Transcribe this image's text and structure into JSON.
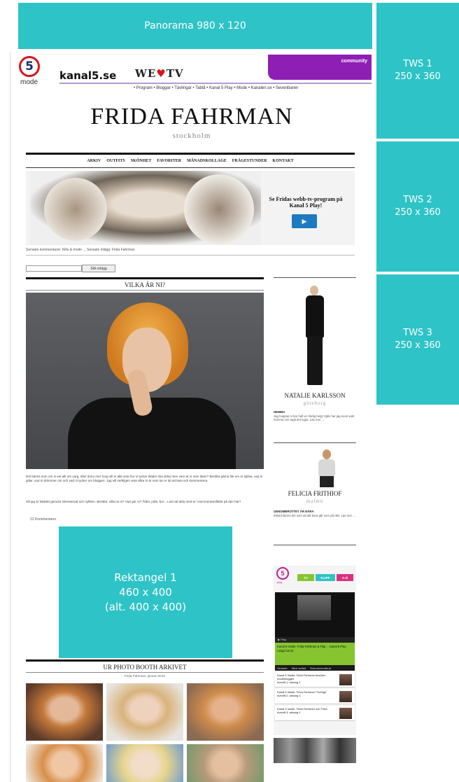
{
  "ads": {
    "panorama": {
      "title": "Panorama 980 x 120"
    },
    "tws1": {
      "title": "TWS 1",
      "size": "250 x 360"
    },
    "tws2": {
      "title": "TWS 2",
      "size": "250 x 360"
    },
    "tws3": {
      "title": "TWS 3",
      "size": "250 x 360"
    },
    "rektangel": {
      "title": "Rektangel 1",
      "size": "460 x 400",
      "alt": "(alt. 400 x 400)"
    }
  },
  "header": {
    "logo_number": "5",
    "logo_sub": "mode",
    "site_name": "kanal5.se",
    "brand_pre": "WE",
    "brand_heart": "♥",
    "brand_post": "TV",
    "community": "community",
    "top_nav": "• Program • Bloggar • Tävlingar • Tablå • Kanal 5 Play • Mode • Kanalen.se • Sevenbaren"
  },
  "blog": {
    "title": "FRIDA FAHRMAN",
    "city": "stockholm"
  },
  "nav": {
    "items": [
      "ARKIV",
      "OUTFITS",
      "SKÖNHET",
      "FAVORITER",
      "MÅNADSKOLLAGE",
      "FRÅGESTUNDER",
      "KONTAKT"
    ]
  },
  "banner": {
    "text": "Se Fridas webb-tv-program på Kanal 5 Play!",
    "play_icon": "▶"
  },
  "breadcrumb": "Senaste kommentarer: Kille & mode ... Senaste inlägg: Frida Fahrman",
  "search": {
    "button": "Sök inlägg"
  },
  "post": {
    "title": "VILKA ÄR NI?",
    "paragraph1": "Det känns som om vi vet allt om varg, eller ännu mer (nog vill ni alla veta hur vi tycker kläder ska sitta) men vem är ni som läser? Berätta gärna lite om er själva, vad ni gillar, vad ni drömmer om och vad ni tycker om bloggen. Jag vill verkligen veta vilka ni är som tar er tid att läsa och kommentera.",
    "paragraph2": "Så jag är faktiskt genuint intresserad och nyfiken. Berätta: vilka är ni? Vad gör ni? Ålder, jobb, bor... Lust att dela med er i kommentarsfältet på den här?",
    "comments": "12 Kommentarer"
  },
  "photobooth": {
    "title": "UR PHOTO BOOTH ARKIVET",
    "caption": "Frida Fahrman, januari 2012"
  },
  "sidebar": {
    "blogger1": {
      "name": "NATALIE KARLSSON",
      "city": "göteborg",
      "heading": "HEMMA",
      "text": "Jag hoppas ni har haft en härlig helg! Själv har jag mest varit hemma och tagit det lugnt. Läs mer ..."
    },
    "blogger2": {
      "name": "FELICIA FRITHIOF",
      "city": "malmö",
      "heading": "GENOMBROTTET ÄR NÄRA",
      "text": "Ibland känns det som att allt bara går som på räls. Läs mer ..."
    }
  },
  "play_widget": {
    "logo": "5",
    "logo_text": "play",
    "tabs": [
      "TV",
      "KLIPP",
      "A-Ö"
    ],
    "controls": "▶ Play",
    "info": "Kanal 5 Inside: Frida Fahrman & Filip ... Kanal 5 Play · Längd 16:33",
    "list_tabs": [
      "Senaste",
      "Mest sedda",
      "Rekommenderat"
    ],
    "items": [
      {
        "title": "Kanal 5 Inside: Frida Fahrman besöker modebloggen",
        "meta": "Avsnitt 1, säsong 1"
      },
      {
        "title": "Kanal 5 Inside: Frida Fahrman i Sverige",
        "meta": "Avsnitt 2, säsong 1"
      },
      {
        "title": "Kanal 5 Inside: Frida Fahrman och Frida",
        "meta": "Avsnitt 3, säsong 1"
      }
    ]
  }
}
